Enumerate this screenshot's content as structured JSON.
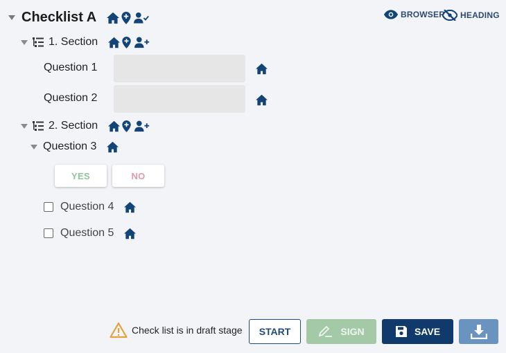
{
  "checklist": {
    "title": "Checklist A"
  },
  "toggles": {
    "browser": "BROWSER",
    "heading": "HEADING"
  },
  "sections": [
    {
      "label": "1. Section"
    },
    {
      "label": "2. Section"
    }
  ],
  "questions": [
    {
      "label": "Question 1"
    },
    {
      "label": "Question 2"
    },
    {
      "label": "Question 3",
      "yes": "YES",
      "no": "NO"
    },
    {
      "label": "Question 4"
    },
    {
      "label": "Question 5"
    }
  ],
  "footer": {
    "status": "Check list is in draft stage",
    "start": "START",
    "sign": "SIGN",
    "save": "SAVE"
  },
  "colors": {
    "primary": "#0f3a6b",
    "icon": "#134478",
    "yes": "#8fc39a",
    "no": "#e39aa9",
    "warning": "#e3a23a"
  }
}
